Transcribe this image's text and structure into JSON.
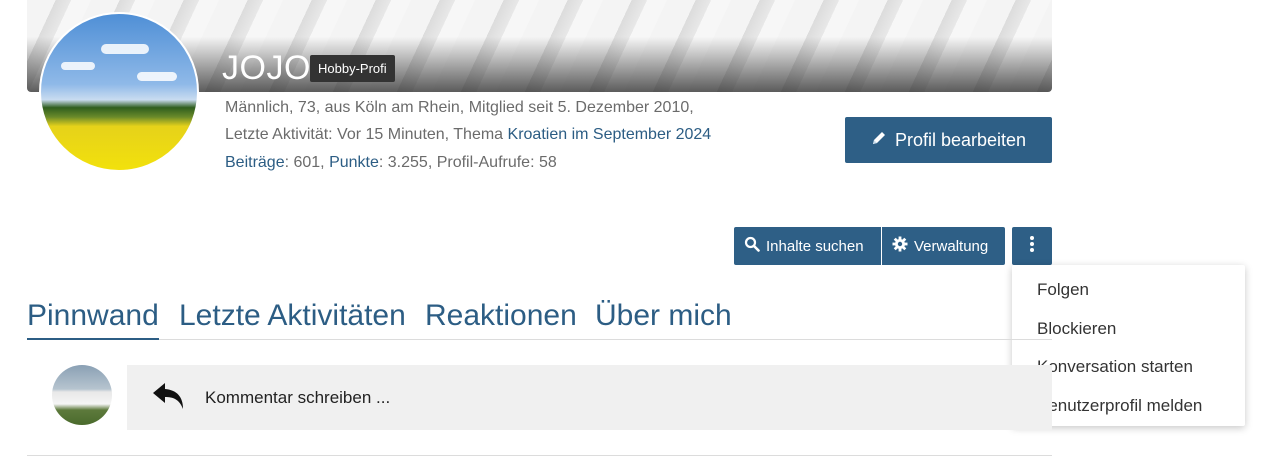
{
  "profile": {
    "username": "JOJO",
    "rank_badge": "Hobby-Profi",
    "meta_line1": "Männlich, 73, aus Köln am Rhein, Mitglied seit 5. Dezember 2010,",
    "meta_line2_prefix": "Letzte Aktivität: Vor 15 Minuten, Thema ",
    "meta_line2_link": "Kroatien im September 2024",
    "stats": {
      "posts_label": "Beiträge",
      "posts_value": ": 601, ",
      "points_label": "Punkte",
      "points_value": ": 3.255, Profil-Aufrufe: 58"
    },
    "edit_button": "Profil bearbeiten"
  },
  "actions": {
    "search_label": "Inhalte suchen",
    "admin_label": "Verwaltung",
    "more_icon": "vertical-ellipsis-icon"
  },
  "dropdown": {
    "items": [
      "Folgen",
      "Blockieren",
      "Konversation starten",
      "Benutzerprofil melden"
    ]
  },
  "tabs": [
    "Pinnwand",
    "Letzte Aktivitäten",
    "Reaktionen",
    "Über mich"
  ],
  "active_tab": "Pinnwand",
  "comment": {
    "placeholder": "Kommentar schreiben ..."
  },
  "colors": {
    "accent": "#2e5f86",
    "link": "#2c5d84",
    "badge": "#333333"
  }
}
